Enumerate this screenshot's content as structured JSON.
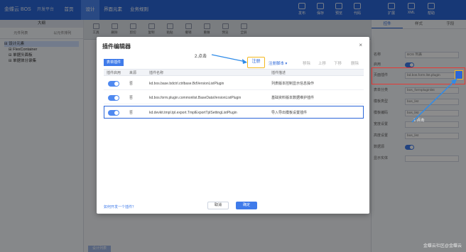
{
  "app": {
    "title": "金蝶云 BOS",
    "version": "开发平台"
  },
  "topmenus": [
    {
      "label": "首页"
    },
    {
      "label": "设计",
      "active": true
    },
    {
      "label": "界面元素"
    },
    {
      "label": "业务规则"
    }
  ],
  "topbar_buttons": [
    {
      "label": "发布",
      "icon": "publish-icon"
    },
    {
      "label": "保存",
      "icon": "save-icon"
    },
    {
      "label": "预览",
      "icon": "preview-icon"
    },
    {
      "label": "代码",
      "icon": "code-icon"
    },
    {
      "label": "扩展",
      "icon": "extend-icon"
    },
    {
      "label": "XML",
      "icon": "xml-icon"
    },
    {
      "label": "帮助",
      "icon": "help-icon"
    }
  ],
  "left_panel": {
    "title": "大纲",
    "subtabs": [
      "元件列表",
      "以元件排列"
    ],
    "tree": [
      {
        "label": "设计元素",
        "selected": true
      },
      {
        "label": "FlexContainer"
      },
      {
        "label": "单据头面板"
      },
      {
        "label": "单据体分录集"
      }
    ]
  },
  "center_toolbar": [
    {
      "label": "工具"
    },
    {
      "label": "删除"
    },
    {
      "label": "剪切"
    },
    {
      "label": "复制"
    },
    {
      "label": "粘贴"
    },
    {
      "label": "撤销"
    },
    {
      "label": "重做"
    },
    {
      "label": "预览"
    },
    {
      "label": "全屏"
    }
  ],
  "right_panel": {
    "tabs": [
      "控件",
      "样式",
      "字段"
    ],
    "properties": [
      {
        "label": "名称",
        "value": "BOS 列表"
      },
      {
        "label": "启用",
        "type": "switch"
      },
      {
        "label": "页面插件",
        "value": "bd.bos.form.list.plugin"
      },
      {
        "label": "表单分类",
        "value": "bos_formpluginlist"
      },
      {
        "label": "模板类型",
        "value": "bos_list"
      },
      {
        "label": "模板编码",
        "value": "bos_list"
      },
      {
        "label": "宽度设置",
        "value": ""
      },
      {
        "label": "高度设置",
        "value": "bos_list"
      },
      {
        "label": "数据源",
        "type": "switch"
      },
      {
        "label": "显示实体",
        "value": ""
      }
    ]
  },
  "bottom_tab": {
    "label": "设计列表"
  },
  "modal": {
    "title": "插件编辑器",
    "close": "×",
    "side_tab": "表单插件",
    "annotation_add": "2.点击",
    "toolbar": [
      {
        "label": "注册",
        "highlight": true
      },
      {
        "label": "注册脚本 ▾"
      },
      {
        "label": "移除",
        "disabled": true
      },
      {
        "label": "上移",
        "disabled": true
      },
      {
        "label": "下移",
        "disabled": true
      },
      {
        "label": "删除",
        "disabled": true
      }
    ],
    "columns": [
      "插件启用",
      "来源",
      "插件名称",
      "插件描述"
    ],
    "rows": [
      {
        "enabled": true,
        "source": "否",
        "name": "kd.bos.base.bdctrl.ctrlbase.BdVersionListPlugin",
        "desc": "列表版本控制显示信息操作"
      },
      {
        "enabled": true,
        "source": "否",
        "name": "kd.bos.form.plugin.commonlist.BaseDataVersionListPlugin",
        "desc": "基础资料版本数据维护插件"
      },
      {
        "enabled": true,
        "source": "否",
        "name": "kd.devkit.tmpl.tpl.export.TmplExportTplSettingListPlugin",
        "desc": "导入导出模板设置插件",
        "selected": true
      }
    ],
    "link": "如何开发一个插件？",
    "cancel": "取消",
    "ok": "确定"
  },
  "annotations": {
    "step1": "1.点击",
    "watermark": "金蝶云社区@金蝶云"
  }
}
